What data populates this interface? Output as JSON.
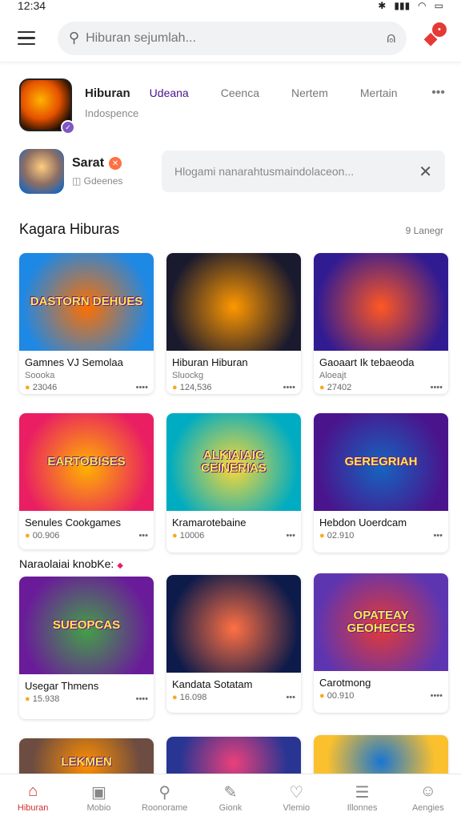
{
  "status": {
    "time": "12:34"
  },
  "search": {
    "placeholder": "Hiburan sejumlah..."
  },
  "app": {
    "name": "Hiburan",
    "tabs": [
      "Udeana",
      "Ceenca",
      "Nertem",
      "Mertain"
    ],
    "subtitle": "Indospence",
    "more": "•••"
  },
  "user": {
    "name": "Sarat",
    "subtitle": "Gdeenes",
    "info": "Hlogami nanarahtusmaindolaceon..."
  },
  "section1": {
    "title": "Kagara Hiburas",
    "link": "9 Lanegr"
  },
  "section2": {
    "title": "Naraolaiai knobKe:"
  },
  "cards": [
    {
      "thumb": "DASTORN DEHUES",
      "title": "Gamnes VJ Semolaa",
      "sub": "Soooka",
      "stat": "23046",
      "dots": "••••",
      "c1": "#1e88e5",
      "c2": "#ff6f00"
    },
    {
      "thumb": "",
      "title": "Hiburan Hiburan",
      "sub": "Sluockg",
      "stat": "124,536",
      "dots": "••••",
      "c1": "#1a1a2e",
      "c2": "#ff9800"
    },
    {
      "thumb": "",
      "title": "Gaoaart Ik tebaeoda",
      "sub": "Aloeajt",
      "stat": "27402",
      "dots": "••••",
      "c1": "#311b92",
      "c2": "#ff5722"
    },
    {
      "thumb": "EARTOBISES",
      "title": "Senules Cookgames",
      "sub": "",
      "stat": "00.906",
      "dots": "•••",
      "c1": "#e91e63",
      "c2": "#ffb300"
    },
    {
      "thumb": "ALKIAIAIC CEINERIAS",
      "title": "Kramarotebaine",
      "sub": "",
      "stat": "10006",
      "dots": "•••",
      "c1": "#00acc1",
      "c2": "#fdd835"
    },
    {
      "thumb": "GEREGRIAH",
      "title": "Hebdon Uoerdcam",
      "sub": "",
      "stat": "02.910",
      "dots": "•••",
      "c1": "#4a148c",
      "c2": "#1565c0"
    },
    {
      "thumb": "SUEOPCAS",
      "title": "Usegar Thmens",
      "sub": "",
      "stat": "15.938",
      "dots": "••••",
      "c1": "#6a1b9a",
      "c2": "#43a047"
    },
    {
      "thumb": "",
      "title": "Kandata Sotatam",
      "sub": "",
      "stat": "16.098",
      "dots": "•••",
      "c1": "#0d1b4a",
      "c2": "#ff7043"
    },
    {
      "thumb": "OPATEAY GEOHECES",
      "title": "Carotmong",
      "sub": "",
      "stat": "00.910",
      "dots": "••••",
      "c1": "#5e35b1",
      "c2": "#e53935"
    },
    {
      "thumb": "LEKMEN",
      "title": "",
      "sub": "",
      "stat": "",
      "dots": "",
      "c1": "#6d4c41",
      "c2": "#ff8f00"
    },
    {
      "thumb": "",
      "title": "",
      "sub": "",
      "stat": "",
      "dots": "",
      "c1": "#283593",
      "c2": "#ec407a"
    },
    {
      "thumb": "",
      "title": "",
      "sub": "",
      "stat": "",
      "dots": "",
      "c1": "#fbc02d",
      "c2": "#1976d2"
    }
  ],
  "nav": [
    {
      "label": "Hiburan",
      "icon": "home-icon",
      "glyph": "⌂"
    },
    {
      "label": "Mobio",
      "icon": "tablet-icon",
      "glyph": "▣"
    },
    {
      "label": "Roonorame",
      "icon": "search-icon",
      "glyph": "⚲"
    },
    {
      "label": "Gionk",
      "icon": "edit-icon",
      "glyph": "✎"
    },
    {
      "label": "Vlemio",
      "icon": "heart-icon",
      "glyph": "♡"
    },
    {
      "label": "Illonnes",
      "icon": "list-icon",
      "glyph": "☰"
    },
    {
      "label": "Aengies",
      "icon": "profile-icon",
      "glyph": "☺"
    }
  ]
}
